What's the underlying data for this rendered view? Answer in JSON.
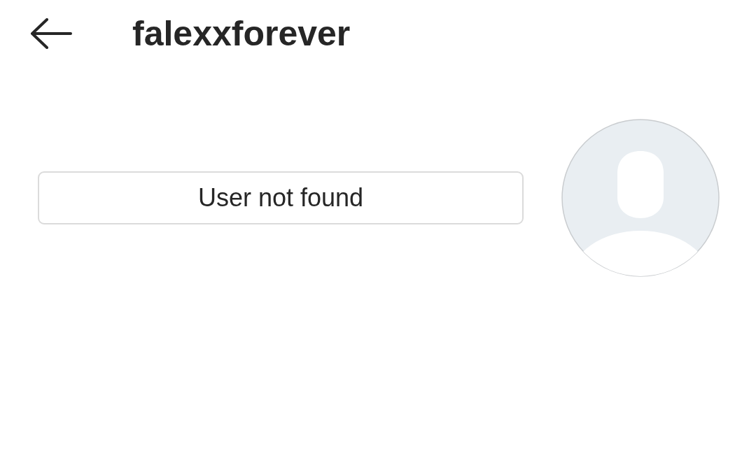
{
  "header": {
    "title": "falexxforever"
  },
  "profile": {
    "message": "User not found"
  }
}
